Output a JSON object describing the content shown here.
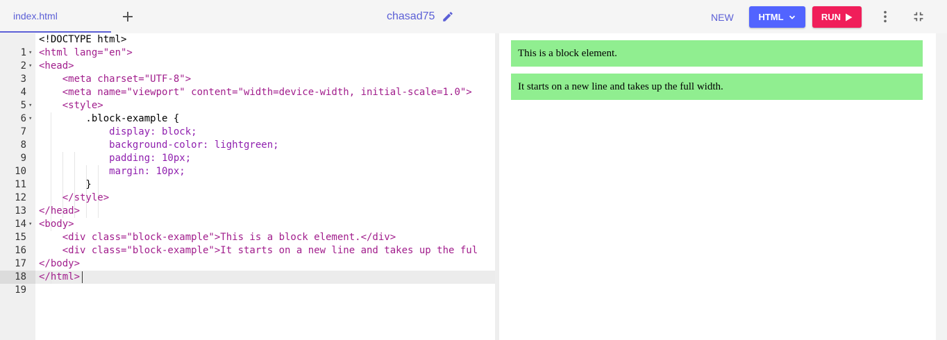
{
  "tab": {
    "label": "index.html"
  },
  "header": {
    "title": "chasad75",
    "new_label": "NEW",
    "lang_label": "HTML",
    "run_label": "RUN"
  },
  "icons": {
    "add": "plus-icon",
    "edit": "pencil-icon",
    "more": "more-vertical-icon",
    "collapse": "collapse-icon",
    "lang_caret": "chevron-down-icon",
    "run": "play-icon"
  },
  "colors": {
    "accent": "#5264ff",
    "run": "#f01e5a",
    "preview_block": "#90ee90"
  },
  "editor": {
    "line_numbers": [
      "1",
      "2",
      "3",
      "4",
      "5",
      "6",
      "7",
      "8",
      "9",
      "10",
      "11",
      "12",
      "13",
      "14",
      "15",
      "16",
      "17",
      "18",
      "19"
    ],
    "active_line": "19",
    "lines": [
      "<!DOCTYPE html>",
      "<html lang=\"en\">",
      "<head>",
      "    <meta charset=\"UTF-8\">",
      "    <meta name=\"viewport\" content=\"width=device-width, initial-scale=1.0\">",
      "    <style>",
      "        .block-example {",
      "            display: block;",
      "            background-color: lightgreen;",
      "            padding: 10px;",
      "            margin: 10px;",
      "        }",
      "    </style>",
      "</head>",
      "<body>",
      "    <div class=\"block-example\">This is a block element.</div>",
      "    <div class=\"block-example\">It starts on a new line and takes up the ful",
      "</body>",
      "</html>"
    ]
  },
  "preview": {
    "blocks": [
      "This is a block element.",
      "It starts on a new line and takes up the full width."
    ]
  }
}
